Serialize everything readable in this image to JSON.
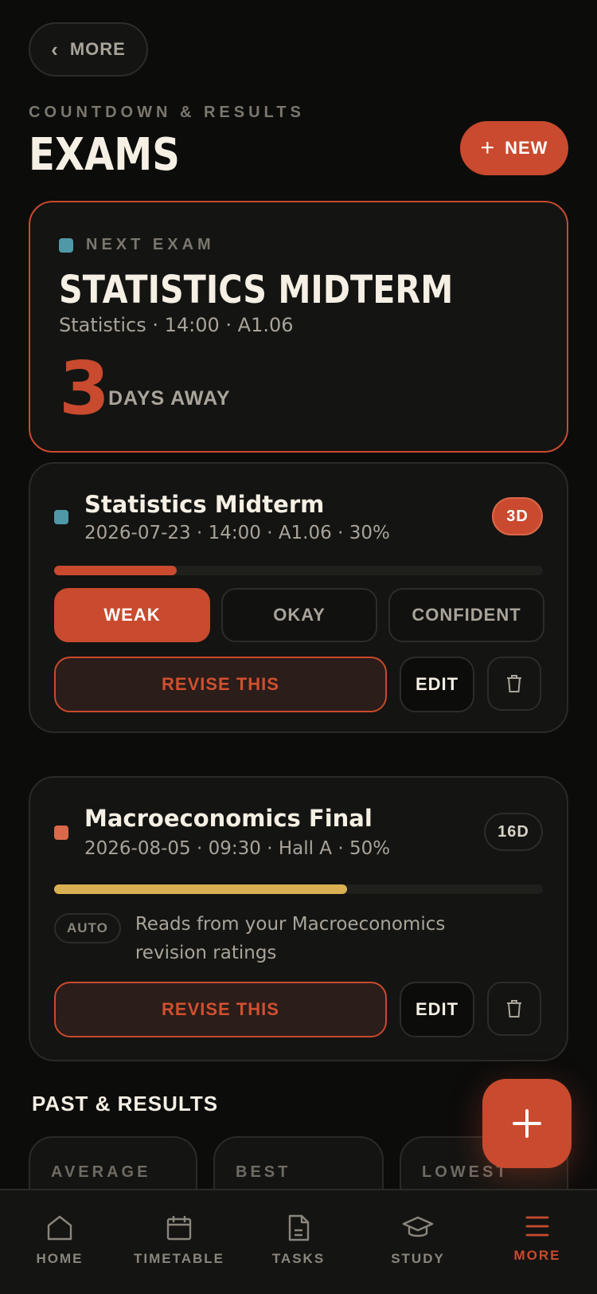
{
  "header": {
    "back_label": "MORE",
    "eyebrow": "COUNTDOWN & RESULTS",
    "title": "EXAMS",
    "new_button": "NEW"
  },
  "next_exam": {
    "tag": "NEXT EXAM",
    "title": "STATISTICS MIDTERM",
    "subtitle": "Statistics · 14:00 · A1.06",
    "days": "3",
    "days_label": "DAYS AWAY",
    "color": "#4f98a8"
  },
  "exams": [
    {
      "title": "Statistics Midterm",
      "subtitle": "2026-07-23 · 14:00 · A1.06 · 30%",
      "badge": "3D",
      "color": "#4f98a8",
      "progress": 0.25,
      "progress_color": "#c94a2e",
      "ratings": [
        "WEAK",
        "OKAY",
        "CONFIDENT"
      ],
      "selected_rating": "WEAK",
      "revise_label": "REVISE THIS",
      "edit_label": "EDIT"
    },
    {
      "title": "Macroeconomics Final",
      "subtitle": "2026-08-05 · 09:30 · Hall A · 50%",
      "badge": "16D",
      "color": "#d9694a",
      "progress": 0.6,
      "progress_color": "#d9b153",
      "auto_label": "AUTO",
      "auto_text": "Reads from your Macroeconomics revision ratings",
      "revise_label": "REVISE THIS",
      "edit_label": "EDIT"
    }
  ],
  "past": {
    "title": "PAST & RESULTS",
    "stats": [
      "AVERAGE",
      "BEST",
      "LOWEST"
    ]
  },
  "nav": [
    {
      "label": "HOME",
      "icon": "home-icon"
    },
    {
      "label": "TIMETABLE",
      "icon": "calendar-icon"
    },
    {
      "label": "TASKS",
      "icon": "document-icon"
    },
    {
      "label": "STUDY",
      "icon": "graduation-cap-icon"
    },
    {
      "label": "MORE",
      "icon": "menu-icon",
      "active": true
    }
  ],
  "colors": {
    "accent": "#c94a2e",
    "background": "#0c0c0b",
    "card": "#141412"
  }
}
